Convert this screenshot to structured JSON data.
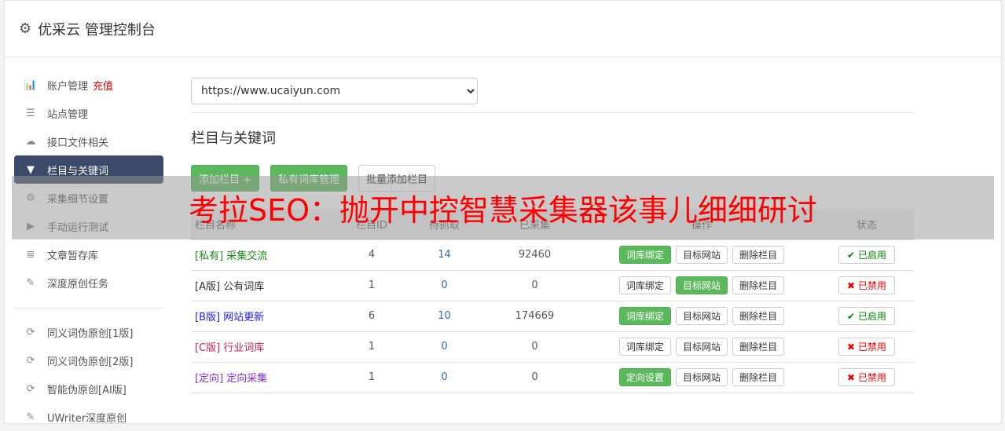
{
  "header": {
    "title": "优采云 管理控制台",
    "icon": "gear-icon"
  },
  "sidebar": {
    "items": [
      {
        "label": "账户管理",
        "extra": "充值",
        "icon": "bar-chart-icon"
      },
      {
        "label": "站点管理",
        "icon": "server-icon"
      },
      {
        "label": "接口文件相关",
        "icon": "cloud-upload-icon"
      },
      {
        "label": "栏目与关键词",
        "icon": "filter-icon",
        "active": true
      },
      {
        "label": "采集细节设置",
        "icon": "gears-icon"
      },
      {
        "label": "手动运行测试",
        "icon": "play-circle-icon"
      },
      {
        "label": "文章暂存库",
        "icon": "database-icon"
      },
      {
        "label": "深度原创任务",
        "icon": "edit-icon"
      }
    ],
    "items2": [
      {
        "label": "同义词伪原创[1版]",
        "icon": "refresh-icon"
      },
      {
        "label": "同义词伪原创[2版]",
        "icon": "refresh-icon"
      },
      {
        "label": "智能伪原创[AI版]",
        "icon": "refresh-icon"
      },
      {
        "label": "UWriter深度原创",
        "icon": "edit-icon"
      }
    ]
  },
  "main": {
    "site_select": "https://www.ucaiyun.com",
    "section_title": "栏目与关键词",
    "buttons": {
      "add": "添加栏目 +",
      "private": "私有词库管理",
      "batch": "批量添加栏目"
    },
    "columns": [
      "栏目名称",
      "栏目ID",
      "待抓取",
      "已采集",
      "操作",
      "状态"
    ],
    "rows": [
      {
        "tag": "[私有]",
        "name": "采集交流",
        "color": "#1a8a1a",
        "id": "4",
        "pending": "14",
        "collected": "92460",
        "b1": "词库绑定",
        "b1_active": true,
        "b2": "目标网站",
        "b2_active": false,
        "b3": "删除栏目",
        "status": "已启用",
        "enabled": true
      },
      {
        "tag": "[A版]",
        "name": "公有词库",
        "color": "#333333",
        "id": "1",
        "pending": "0",
        "collected": "0",
        "b1": "词库绑定",
        "b1_active": false,
        "b2": "目标网站",
        "b2_active": true,
        "b3": "删除栏目",
        "status": "已禁用",
        "enabled": false
      },
      {
        "tag": "[B版]",
        "name": "网站更新",
        "color": "#1a1aff",
        "id": "6",
        "pending": "10",
        "collected": "174669",
        "b1": "词库绑定",
        "b1_active": true,
        "b2": "目标网站",
        "b2_active": false,
        "b3": "删除栏目",
        "status": "已启用",
        "enabled": true
      },
      {
        "tag": "[C版]",
        "name": "行业词库",
        "color": "#c7254e",
        "id": "1",
        "pending": "0",
        "collected": "0",
        "b1": "词库绑定",
        "b1_active": false,
        "b2": "目标网站",
        "b2_active": false,
        "b3": "删除栏目",
        "status": "已禁用",
        "enabled": false
      },
      {
        "tag": "[定向]",
        "name": "定向采集",
        "color": "#8a2be2",
        "id": "1",
        "pending": "0",
        "collected": "0",
        "b1": "定向设置",
        "b1_active": true,
        "b2": "目标网站",
        "b2_active": false,
        "b3": "删除栏目",
        "status": "已禁用",
        "enabled": false
      }
    ]
  },
  "overlay": {
    "text": "考拉SEO：抛开中控智慧采集器该事儿细细研讨"
  }
}
